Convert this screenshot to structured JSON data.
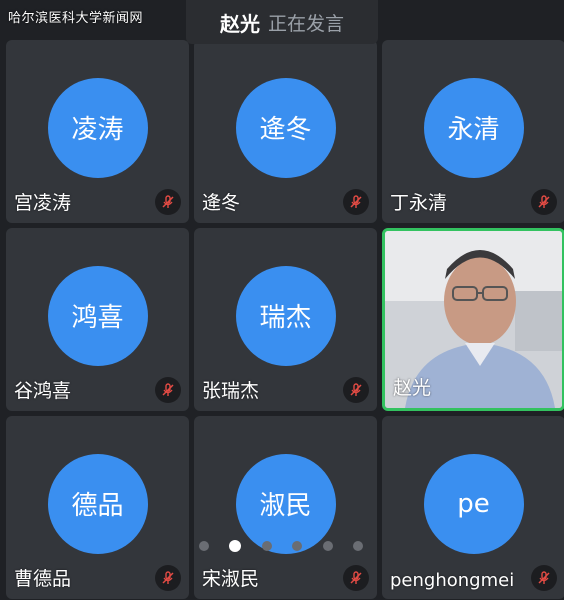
{
  "watermark": "哈尔滨医科大学新闻网",
  "speaker": {
    "name": "赵光",
    "status": "正在发言"
  },
  "participants": [
    {
      "avatar_text": "凌涛",
      "name": "宫凌涛",
      "muted": true
    },
    {
      "avatar_text": "逄冬",
      "name": "逄冬",
      "muted": true
    },
    {
      "avatar_text": "永清",
      "name": "丁永清",
      "muted": true
    },
    {
      "avatar_text": "鸿喜",
      "name": "谷鸿喜",
      "muted": true
    },
    {
      "avatar_text": "瑞杰",
      "name": "张瑞杰",
      "muted": true
    },
    {
      "avatar_text": "",
      "name": "赵光",
      "muted": false,
      "video": true,
      "active_speaker": true
    },
    {
      "avatar_text": "德品",
      "name": "曹德品",
      "muted": true
    },
    {
      "avatar_text": "淑民",
      "name": "宋淑民",
      "muted": true
    },
    {
      "avatar_text": "pe",
      "name": "penghongmei",
      "muted": true
    }
  ],
  "pager": {
    "pages": 6,
    "current": 2
  },
  "colors": {
    "avatar": "#3a8ff0",
    "active_border": "#33c260",
    "mute_icon": "#e34b44",
    "tile_bg": "#33363b"
  }
}
